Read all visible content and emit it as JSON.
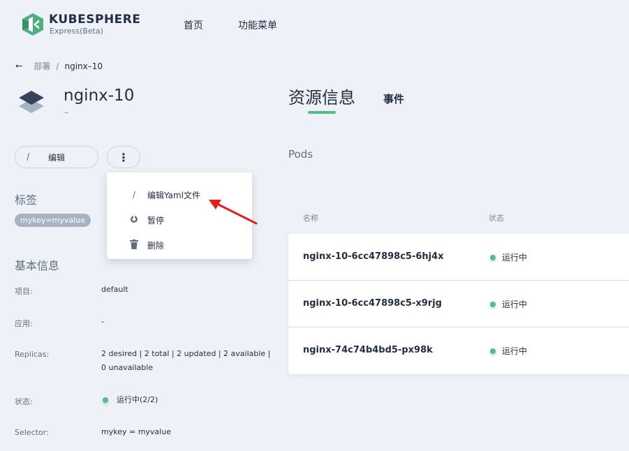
{
  "header": {
    "brand_name": "KUBESPHERE",
    "brand_sub": "Express(Beta)",
    "nav": [
      "首页",
      "功能菜单"
    ]
  },
  "breadcrumb": {
    "parent": "部署",
    "separator": "/",
    "current": "nginx–10"
  },
  "workload": {
    "name": "nginx-10",
    "description": "–"
  },
  "actions": {
    "edit_label": "编辑",
    "more_label": "⋮"
  },
  "dropdown": {
    "items": [
      {
        "label": "编辑Yaml文件",
        "icon": "pen-icon"
      },
      {
        "label": "暂停",
        "icon": "pause-icon"
      },
      {
        "label": "删除",
        "icon": "trash-icon"
      }
    ]
  },
  "labels_section": {
    "title": "标签",
    "tag": "mykey=myvalue"
  },
  "basic_info": {
    "title": "基本信息",
    "rows": [
      {
        "label": "项目:",
        "value": "default"
      },
      {
        "label": "应用:",
        "value": "-"
      },
      {
        "label": "Replicas:",
        "value": "2 desired | 2 total | 2 updated | 2 available | 0 unavailable"
      },
      {
        "label": "状态:",
        "value": "运行中(2/2)"
      },
      {
        "label": "Selector:",
        "value": "mykey = myvalue"
      }
    ]
  },
  "tabs": {
    "resource": "资源信息",
    "events": "事件"
  },
  "pods": {
    "title": "Pods",
    "columns": [
      "名称",
      "状态"
    ],
    "rows": [
      {
        "name": "nginx-10-6cc47898c5-6hj4x",
        "status": "运行中"
      },
      {
        "name": "nginx-10-6cc47898c5-x9rjg",
        "status": "运行中"
      },
      {
        "name": "nginx-74c74b4bd5-px98k",
        "status": "运行中"
      }
    ]
  },
  "colors": {
    "accent": "#55bc8a",
    "arrow": "#e02020",
    "background": "#eef2f8"
  }
}
